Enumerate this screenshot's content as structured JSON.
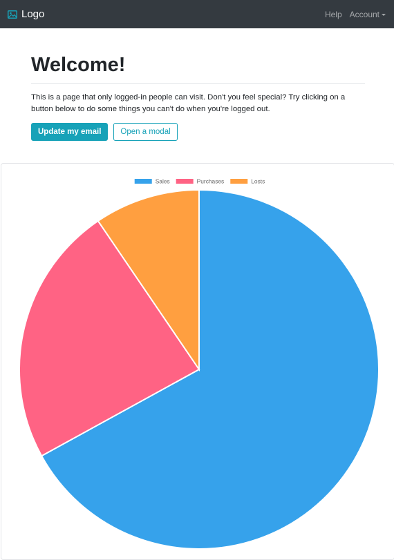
{
  "navbar": {
    "brand": "Logo",
    "brand_icon": "image-icon",
    "links": [
      "Help",
      "Account"
    ]
  },
  "jumbotron": {
    "title": "Welcome!",
    "text": "This is a page that only logged-in people can visit. Don't you feel special? Try clicking on a button below to do some things you can't do when you're logged out.",
    "primary_button": "Update my email",
    "secondary_button": "Open a modal"
  },
  "colors": {
    "navbar": "#343a40",
    "accent": "#17a2b8"
  },
  "chart_data": {
    "type": "pie",
    "title": "",
    "legend_position": "top",
    "labels": [
      "Sales",
      "Purchases",
      "Losts"
    ],
    "values": [
      67,
      23.5,
      9.5
    ],
    "colors": [
      "#36a2eb",
      "#ff6384",
      "#ff9f40"
    ]
  }
}
